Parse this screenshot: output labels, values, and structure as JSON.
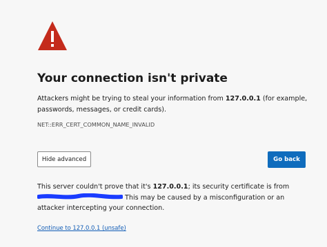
{
  "page": {
    "title": "Your connection isn't private",
    "description_before": "Attackers might be trying to steal your information from ",
    "host": "127.0.0.1",
    "description_after": " (for example, passwords, messages, or credit cards).",
    "error_code": "NET::ERR_CERT_COMMON_NAME_INVALID"
  },
  "buttons": {
    "hide_advanced": "Hide advanced",
    "go_back": "Go back"
  },
  "advanced": {
    "text_before": "This server couldn't prove that it's ",
    "host": "127.0.0.1",
    "text_middle": "; its security certificate is from",
    "text_after": " This may be caused by a misconfiguration or an attacker intercepting your connection.",
    "redaction_color": "#1a3cff"
  },
  "link": {
    "continue": "Continue to 127.0.0.1 (unsafe)"
  },
  "colors": {
    "warning_red": "#c42b1c",
    "primary_blue": "#0f6cbd",
    "link_blue": "#0f5bb5",
    "background": "#f7f7f7"
  },
  "icons": {
    "warning": "warning-triangle-icon"
  }
}
